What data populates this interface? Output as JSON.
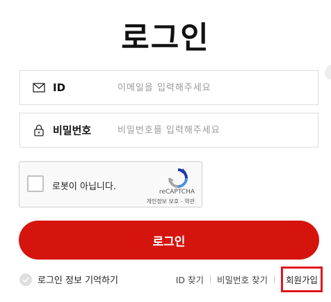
{
  "page": {
    "title": "로그인"
  },
  "form": {
    "id_field": {
      "label": "ID",
      "placeholder": "이메일을 입력해주세요",
      "icon": "envelope-icon"
    },
    "password_field": {
      "label": "비밀번호",
      "placeholder": "비밀번호를 입력해주세요",
      "icon": "lock-icon"
    }
  },
  "captcha": {
    "label": "로봇이 아닙니다.",
    "brand": "reCAPTCHA",
    "terms": "개인정보 보호 - 약관",
    "icon": "recaptcha-icon"
  },
  "submit": {
    "label": "로그인",
    "color": "#d6140e"
  },
  "options": {
    "remember_label": "로그인 정보 기억하기",
    "find_id": "ID 찾기",
    "find_password": "비밀번호 찾기",
    "signup": "회원가입",
    "highlight_color": "#e0151b"
  }
}
